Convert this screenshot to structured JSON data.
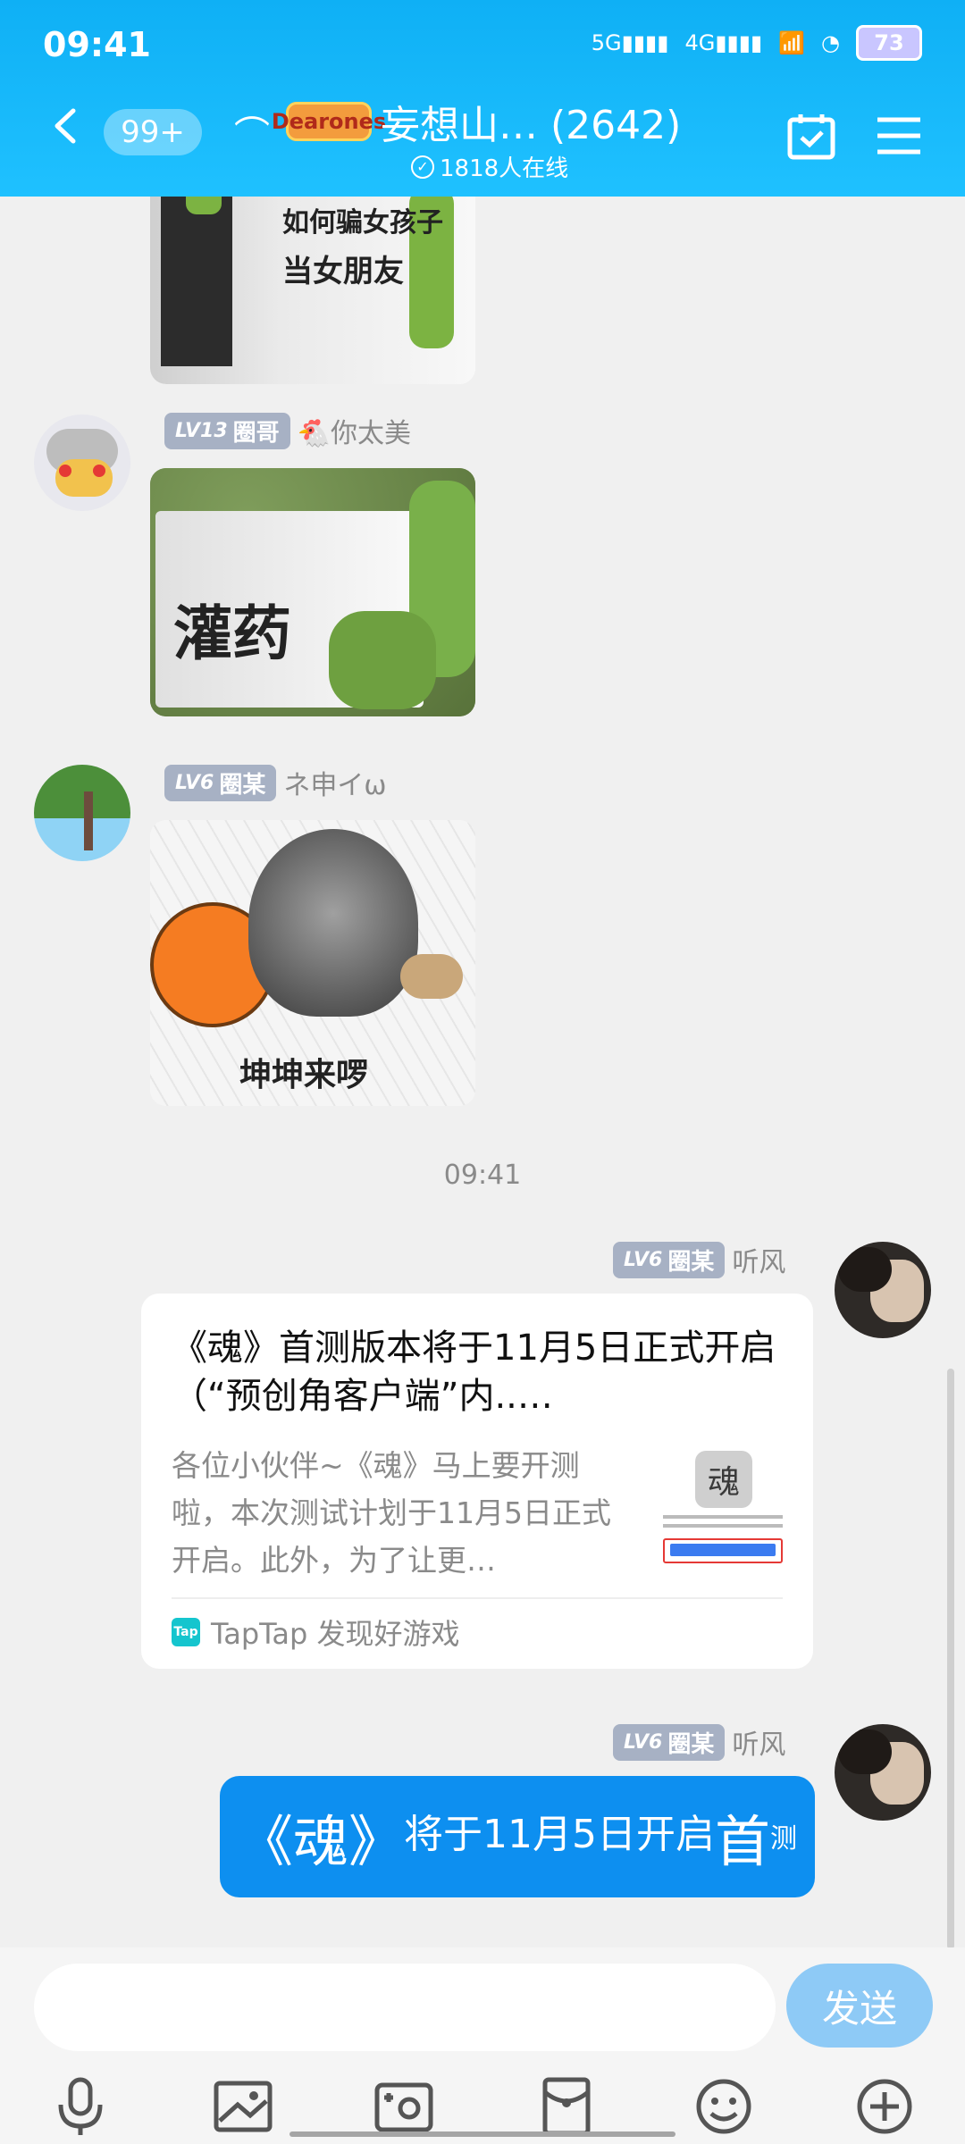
{
  "status_bar": {
    "time": "09:41",
    "net1": "5G",
    "net2": "4G",
    "battery": "73"
  },
  "header": {
    "unread_badge": "99+",
    "title": "妄想山… (2642)",
    "logo_text": "Dearones",
    "online_text": "1818人在线"
  },
  "messages": [
    {
      "kind": "sticker",
      "caption": "当女朋友",
      "caption_top": "如何骗女孩子"
    },
    {
      "kind": "sticker",
      "level": "LV13",
      "title": "圈哥",
      "nickname": "🐔你太美",
      "caption": "灌药"
    },
    {
      "kind": "sticker",
      "level": "LV6",
      "title": "圈某",
      "nickname": "ネ申イω",
      "caption": "坤坤来啰"
    },
    {
      "kind": "time",
      "text": "09:41"
    },
    {
      "kind": "card",
      "level": "LV6",
      "title": "圈某",
      "nickname": "听风",
      "card_title": "《魂》首测版本将于11月5日正式开启（“预创角客户端”内..…",
      "card_desc": "各位小伙伴~《魂》马上要开测啦，本次测试计划于11月5日正式开启。此外，为了让更…",
      "source": "TapTap 发现好游戏",
      "tap_logo": "Tap"
    },
    {
      "kind": "text",
      "level": "LV6",
      "title": "圈某",
      "nickname": "听风",
      "part1": "《魂》",
      "part2": "将于",
      "part3": "11月5日开启",
      "part4": "首",
      "part5": "测"
    }
  ],
  "input": {
    "placeholder": "",
    "send_label": "发送"
  },
  "toolbar": [
    "microphone-icon",
    "picture-icon",
    "camera-icon",
    "red-envelope-icon",
    "emoji-icon",
    "plus-icon"
  ],
  "colors": {
    "header": "#1fc1ff",
    "bubble": "#0d8ff0",
    "send": "#8ecaf6"
  }
}
